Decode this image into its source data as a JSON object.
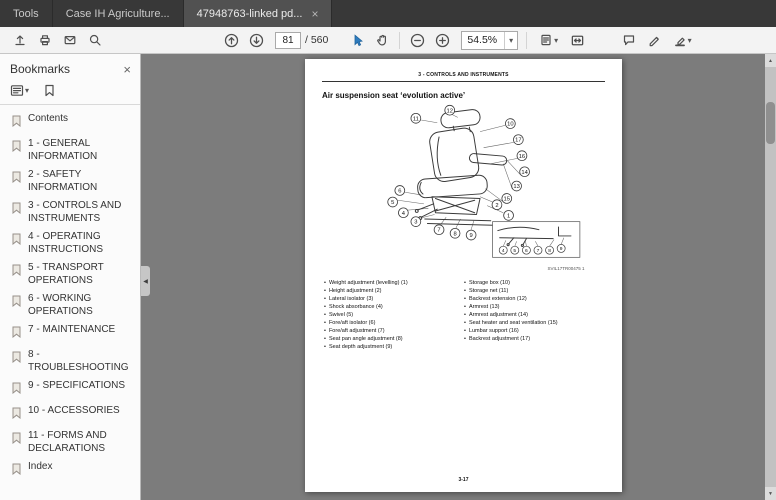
{
  "ui": {
    "close_glyph": "×",
    "dropdown_glyph": "▾",
    "collapse_glyph": "◀",
    "scroll_up_glyph": "▲",
    "scroll_down_glyph": "▼"
  },
  "tab_bar": {
    "tabs": [
      {
        "label": "Tools"
      },
      {
        "label": "Case IH Agriculture..."
      },
      {
        "label": "47948763-linked pd..."
      }
    ]
  },
  "toolbar": {
    "page_current": "81",
    "page_divider": "/",
    "page_total": "560",
    "zoom_value": "54.5%"
  },
  "sidebar": {
    "title": "Bookmarks",
    "items": [
      "Contents",
      "1 - GENERAL INFORMATION",
      "2 - SAFETY INFORMATION",
      "3 - CONTROLS AND INSTRUMENTS",
      "4 - OPERATING INSTRUCTIONS",
      "5 - TRANSPORT OPERATIONS",
      "6 - WORKING OPERATIONS",
      "7 - MAINTENANCE",
      "8 - TROUBLESHOOTING",
      "9 - SPECIFICATIONS",
      "10 - ACCESSORIES",
      "11 - FORMS AND DECLARATIONS",
      "Index"
    ]
  },
  "document": {
    "header": "3 - CONTROLS AND INSTRUMENTS",
    "title": "Air suspension seat ‘evolution active’",
    "figure_caption": "SVIL17TR00475 1",
    "callouts": [
      "1",
      "2",
      "3",
      "4",
      "5",
      "6",
      "7",
      "8",
      "9",
      "10",
      "11",
      "12",
      "13",
      "14",
      "15",
      "16",
      "17"
    ],
    "items_left": [
      "Weight adjustment (levelling) (1)",
      "Height adjustment (2)",
      "Lateral isolator (3)",
      "Shock absorbance (4)",
      "Swivel (5)",
      "Fore/aft isolator (6)",
      "Fore/aft adjustment (7)",
      "Seat pan angle adjustment (8)",
      "Seat depth adjustment (9)"
    ],
    "items_right": [
      "Storage box (10)",
      "Storage net (11)",
      "Backrest extension (12)",
      "Armrest (13)",
      "Armrest adjustment (14)",
      "Seat heater and seat ventilation (15)",
      "Lumbar support (16)",
      "Backrest adjustment (17)"
    ],
    "page_number": "3-17"
  }
}
